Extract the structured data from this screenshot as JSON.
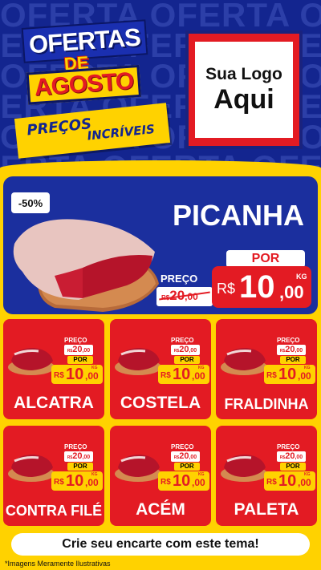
{
  "header": {
    "bg_word": "OFERTA",
    "title_line1": "OFERTAS",
    "title_line2": "DE",
    "title_line3": "AGOSTO",
    "subtitle_line1": "PREÇOS",
    "subtitle_line2": "INCRÍVEIS",
    "logo_line1": "Sua Logo",
    "logo_line2": "Aqui"
  },
  "featured": {
    "badge": "-50%",
    "name": "PICANHA",
    "por_label": "POR",
    "preco_label": "PREÇO",
    "old_currency": "R$",
    "old_int": "20",
    "old_dec": ",00",
    "new_currency": "R$",
    "new_int": "10",
    "new_dec": ",00",
    "unit": "KG"
  },
  "cards": [
    {
      "name": "ALCATRA",
      "preco": "PREÇO",
      "old": "20",
      "old_dec": ",00",
      "old_currency": "R$",
      "por": "POR",
      "currency": "R$",
      "int": "10",
      "dec": ",00",
      "unit": "KG"
    },
    {
      "name": "COSTELA",
      "preco": "PREÇO",
      "old": "20",
      "old_dec": ",00",
      "old_currency": "R$",
      "por": "POR",
      "currency": "R$",
      "int": "10",
      "dec": ",00",
      "unit": "KG"
    },
    {
      "name": "FRALDINHA",
      "preco": "PREÇO",
      "old": "20",
      "old_dec": ",00",
      "old_currency": "R$",
      "por": "POR",
      "currency": "R$",
      "int": "10",
      "dec": ",00",
      "unit": "KG"
    },
    {
      "name": "CONTRA FILÉ",
      "preco": "PREÇO",
      "old": "20",
      "old_dec": ",00",
      "old_currency": "R$",
      "por": "POR",
      "currency": "R$",
      "int": "10",
      "dec": ",00",
      "unit": "KG"
    },
    {
      "name": "ACÉM",
      "preco": "PREÇO",
      "old": "20",
      "old_dec": ",00",
      "old_currency": "R$",
      "por": "POR",
      "currency": "R$",
      "int": "10",
      "dec": ",00",
      "unit": "KG"
    },
    {
      "name": "PALETA",
      "preco": "PREÇO",
      "old": "20",
      "old_dec": ",00",
      "old_currency": "R$",
      "por": "POR",
      "currency": "R$",
      "int": "10",
      "dec": ",00",
      "unit": "KG"
    }
  ],
  "cta": "Crie seu encarte com este tema!",
  "footnote": "*Imagens Meramente Ilustrativas",
  "colors": {
    "blue": "#13258f",
    "yellow": "#ffd200",
    "red": "#e31b23"
  },
  "icons": [
    "meat-image"
  ]
}
